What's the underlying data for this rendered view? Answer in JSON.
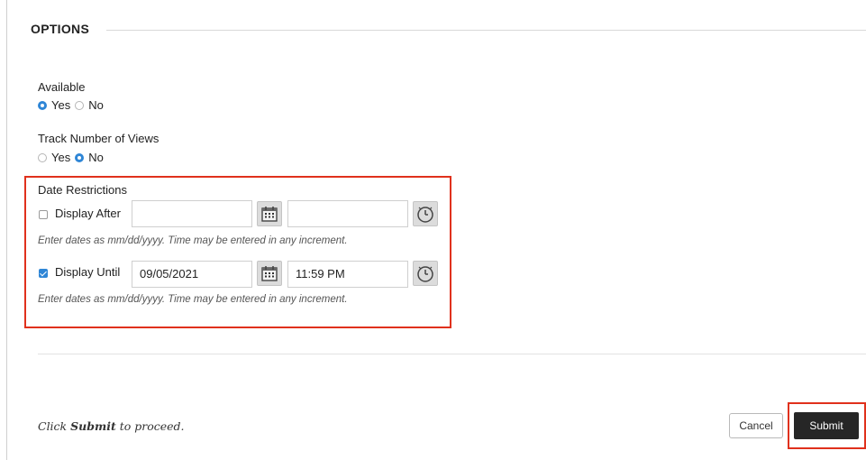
{
  "section": {
    "title": "OPTIONS"
  },
  "available": {
    "label": "Available",
    "options": [
      "Yes",
      "No"
    ],
    "selected": "Yes"
  },
  "track_views": {
    "label": "Track Number of Views",
    "options": [
      "Yes",
      "No"
    ],
    "selected": "No"
  },
  "date_restrictions": {
    "label": "Date Restrictions",
    "display_after": {
      "label": "Display After",
      "checked": false,
      "date": "",
      "time": ""
    },
    "display_until": {
      "label": "Display Until",
      "checked": true,
      "date": "09/05/2021",
      "time": "11:59 PM"
    },
    "hint": "Enter dates as mm/dd/yyyy. Time may be entered in any increment."
  },
  "footer": {
    "prefix": "Click ",
    "bold": "Submit",
    "suffix": " to proceed.",
    "cancel_label": "Cancel",
    "submit_label": "Submit"
  },
  "colors": {
    "accent_blue": "#2f86d6",
    "highlight_red": "#e0311c",
    "submit_bg": "#262626"
  },
  "icons": [
    "calendar-icon",
    "clock-icon"
  ]
}
